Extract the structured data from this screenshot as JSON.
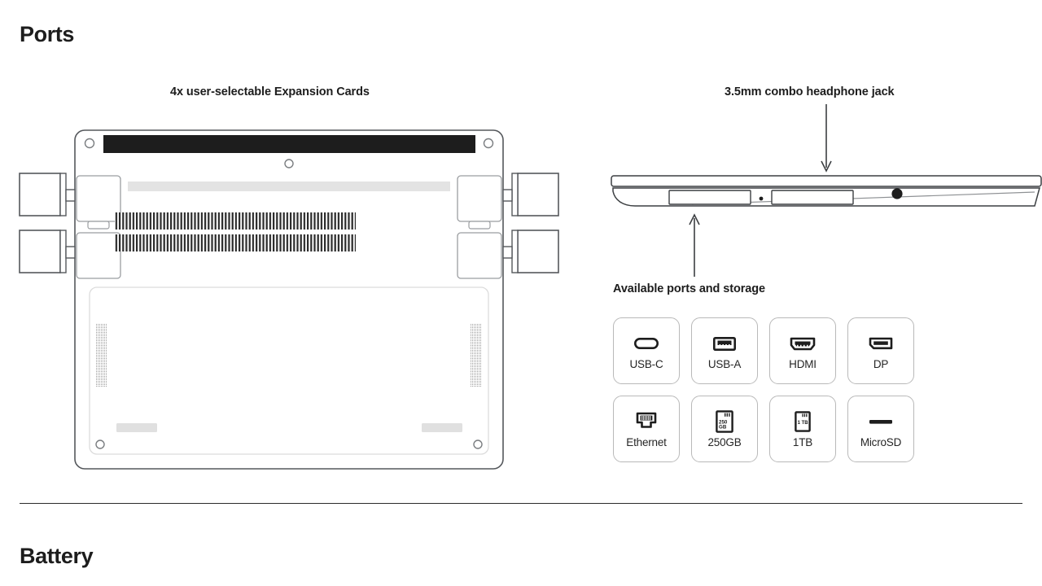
{
  "sections": {
    "ports": {
      "title": "Ports"
    },
    "battery": {
      "title": "Battery"
    }
  },
  "captions": {
    "expansion_cards": "4x user-selectable Expansion Cards",
    "headphone_jack": "3.5mm combo headphone jack",
    "available_ports": "Available ports and storage"
  },
  "diagrams": {
    "laptop_bottom": {
      "name": "laptop-bottom-view",
      "features": [
        "hinge-bar",
        "screw-holes",
        "vent-slats",
        "speaker-grilles",
        "rubber-feet",
        "expansion-card-bays"
      ],
      "expansion_card_count": 4
    },
    "laptop_side": {
      "name": "laptop-side-profile",
      "features": [
        "expansion-card-slot-left",
        "status-led",
        "expansion-card-slot-right",
        "headphone-jack-hole"
      ]
    }
  },
  "port_cards": [
    {
      "id": "usb-c",
      "label": "USB-C",
      "icon": "usb-c-port-icon"
    },
    {
      "id": "usb-a",
      "label": "USB-A",
      "icon": "usb-a-port-icon"
    },
    {
      "id": "hdmi",
      "label": "HDMI",
      "icon": "hdmi-port-icon"
    },
    {
      "id": "dp",
      "label": "DP",
      "icon": "displayport-port-icon"
    },
    {
      "id": "ethernet",
      "label": "Ethernet",
      "icon": "ethernet-rj45-icon"
    },
    {
      "id": "250gb",
      "label": "250GB",
      "icon": "storage-card-icon",
      "icon_text_top": "250",
      "icon_text_bottom": "GB"
    },
    {
      "id": "1tb",
      "label": "1TB",
      "icon": "storage-card-icon",
      "icon_text_top": "1 TB",
      "icon_text_bottom": ""
    },
    {
      "id": "microsd",
      "label": "MicroSD",
      "icon": "microsd-card-icon"
    }
  ],
  "colors": {
    "text": "#1d1d1d",
    "card_border": "#b9b9b9",
    "outline": "#4a4a4a",
    "hinge_bar": "#1d1d1d",
    "panel_fill": "#e3e3e3",
    "divider": "#2b2b2b"
  }
}
